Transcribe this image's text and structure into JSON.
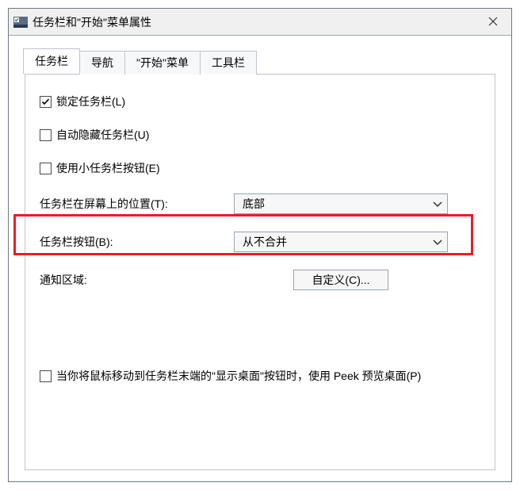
{
  "window": {
    "title": "任务栏和\"开始\"菜单属性"
  },
  "tabs": {
    "taskbar": {
      "label": "任务栏",
      "active": true
    },
    "navigation": {
      "label": "导航",
      "active": false
    },
    "start_menu": {
      "label": "\"开始\"菜单",
      "active": false
    },
    "toolbars": {
      "label": "工具栏",
      "active": false
    }
  },
  "options": {
    "lock_taskbar": {
      "label": "锁定任务栏(L)",
      "checked": true
    },
    "auto_hide_taskbar": {
      "label": "自动隐藏任务栏(U)",
      "checked": false
    },
    "use_small_buttons": {
      "label": "使用小任务栏按钮(E)",
      "checked": false
    },
    "peek_preview": {
      "label": "当你将鼠标移动到任务栏末端的\"显示桌面\"按钮时，使用 Peek 预览桌面(P)",
      "checked": false
    }
  },
  "position": {
    "label": "任务栏在屏幕上的位置(T):",
    "selected": "底部"
  },
  "buttons_combine": {
    "label": "任务栏按钮(B):",
    "selected": "从不合并"
  },
  "notification_area": {
    "label": "通知区域:",
    "button": "自定义(C)..."
  }
}
